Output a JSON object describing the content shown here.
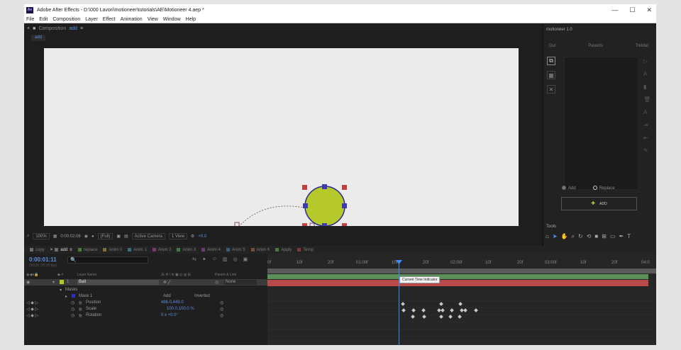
{
  "window": {
    "title": "Adobe After Effects - D:\\000 Lavori\\motioneer\\tutorials\\AE\\Motioneer 4.aep *",
    "logo": "Ae"
  },
  "menu": [
    "File",
    "Edit",
    "Composition",
    "Layer",
    "Effect",
    "Animation",
    "View",
    "Window",
    "Help"
  ],
  "composition": {
    "panel_label": "Composition",
    "comp_name": "add",
    "breadcrumb": "add"
  },
  "viewer": {
    "zoom": "100%",
    "time": "0:00:02:06",
    "resolution": "(Full)",
    "camera": "Active Camera",
    "views": "1 View",
    "exposure": "+0.0"
  },
  "motioneer": {
    "title": "motioneer 1.0",
    "cols": [
      "Dur",
      "Parents",
      "TrkMat"
    ],
    "radio_add": "Add",
    "radio_replace": "Replace",
    "add_button": "ADD"
  },
  "tools": {
    "title": "Tools"
  },
  "timeline_tabs": [
    {
      "label": "copy",
      "color": "#6e6e6e"
    },
    {
      "label": "add",
      "color": "#6e6e6e"
    },
    {
      "label": "replace",
      "color": "#4b7a3a"
    },
    {
      "label": "Anim 0",
      "color": "#7a6e3a"
    },
    {
      "label": "Anim 1",
      "color": "#3a6e7a"
    },
    {
      "label": "Anim 2",
      "color": "#7a3a6e"
    },
    {
      "label": "Anim 3",
      "color": "#3a7a4b"
    },
    {
      "label": "Anim 4",
      "color": "#6e3a7a"
    },
    {
      "label": "Anim 5",
      "color": "#3a5a7a"
    },
    {
      "label": "Anim 6",
      "color": "#7a4b3a"
    },
    {
      "label": "Apply",
      "color": "#4b7a3a"
    },
    {
      "label": "Temp",
      "color": "#7a3a3a"
    }
  ],
  "timeline": {
    "timecode": "0:00:01:11",
    "fps": "00035 (25.00 fps)",
    "search_icon": "🔍",
    "headers": {
      "layer_name": "Layer Name",
      "parent": "Parent & Link"
    },
    "layer": {
      "num": "1",
      "name": "Ball",
      "parent": "None"
    },
    "masks_label": "Masks",
    "mask": {
      "name": "Mask 1",
      "mode": "Add",
      "inverted": "Inverted"
    },
    "props": [
      {
        "name": "Position",
        "value": "486.0,449.0"
      },
      {
        "name": "Scale",
        "value": "100.0,100.0 %"
      },
      {
        "name": "Rotation",
        "value": "0 x +0.0°"
      }
    ],
    "ruler": [
      "0f",
      "10f",
      "20f",
      "01:00f",
      "10f",
      "20f",
      "02:00f",
      "10f",
      "20f",
      "03:00f",
      "10f",
      "20f",
      "04:0"
    ],
    "tooltip": "Current Time Indicator"
  }
}
